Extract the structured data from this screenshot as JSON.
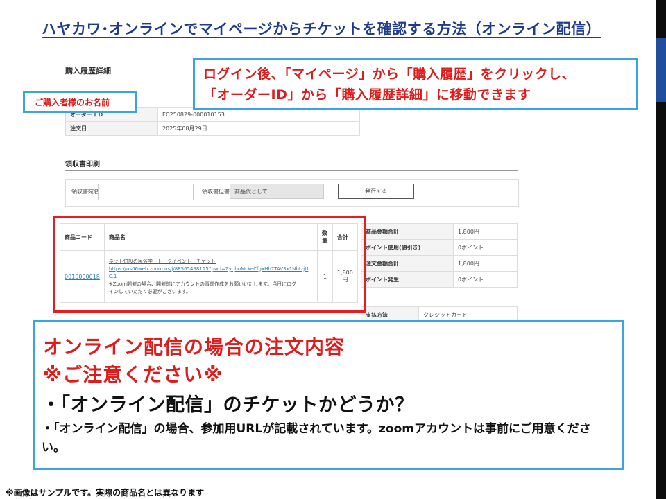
{
  "slide": {
    "title": "ハヤカワ･オンラインでマイページからチケットを確認する方法（オンライン配信）",
    "footnote": "※画像はサンプルです。実際の商品名とは異なります"
  },
  "page": {
    "heading": "購入履歴詳細",
    "order_rows": [
      {
        "label": "オーダーＩＤ",
        "value": "EC250829-000010153"
      },
      {
        "label": "注文日",
        "value": "2025年08月29日"
      }
    ],
    "receipt": {
      "heading": "領収書印刷",
      "addressee_label": "領収書宛名",
      "note_label": "領収書但書",
      "note_value": "商品代として",
      "issue_button": "発行する"
    },
    "items_table": {
      "headers": [
        "商品コード",
        "商品名",
        "数量",
        "合計"
      ],
      "row": {
        "code": "0010000018",
        "name": "ネット併設の民俗学　トークイベント　チケット",
        "url_line1": "https://us06web.zoom.us/j/88565498115?pwd=ZyqbuMckeCfgxHh7TAV3x1NbtzjU",
        "url_line2": "C.1",
        "note_line1": "※Zoom開催の場合、開催前にアカウントの事前作成をお願いいたします。当日にログ",
        "note_line2": "インしていただく必要がございます。",
        "qty": "1",
        "total_line1": "1,800",
        "total_line2": "円"
      }
    },
    "summary_rows": [
      {
        "label": "商品金額合計",
        "value": "1,800円"
      },
      {
        "label": "ポイント使用(値引き)",
        "value": "0ポイント"
      },
      {
        "label": "注文金額合計",
        "value": "1,800円"
      },
      {
        "label": "ポイント発生",
        "value": "0ポイント"
      }
    ],
    "payment": {
      "label": "支払方法",
      "value": "クレジットカード"
    }
  },
  "callouts": {
    "top_line1": "ログイン後、「マイページ」から「購入履歴」をクリックし、",
    "top_line2": "「オーダーID」から「購入履歴詳細」に移動できます",
    "name_label": "ご購入者様のお名前",
    "bottom_line1": "オンライン配信の場合の注文内容",
    "bottom_line2": "※ご注意ください※",
    "bottom_line3": "・「オンライン配信」のチケットかどうか？",
    "bottom_line4": "・「オンライン配信」の場合、参加用URLが記載されています。zoomアカウントは事前にご用意ください。"
  }
}
